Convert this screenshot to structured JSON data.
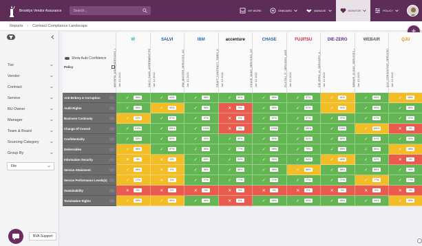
{
  "brand": {
    "name": "Brooklyn Vendor Assurance"
  },
  "search": {
    "placeholder": "Search..."
  },
  "nav": [
    {
      "label": "MY WORK",
      "icon": "inbox-icon",
      "active": false
    },
    {
      "label": "ONBOARD",
      "icon": "plus-circle-icon",
      "active": false
    },
    {
      "label": "MANAGE",
      "icon": "handshake-icon",
      "active": false
    },
    {
      "label": "MONITOR",
      "icon": "heart-pulse-icon",
      "active": true
    },
    {
      "label": "POLICY",
      "icon": "sliders-icon",
      "active": false
    }
  ],
  "breadcrumb": {
    "root": "Reports",
    "current": "Contract Compliance Landscape"
  },
  "sidebar": {
    "filters": [
      "Tier",
      "Vendor",
      "Contract",
      "Service",
      "BU Owner",
      "Manager",
      "Team & Board",
      "Sourcing Category",
      "Group By"
    ],
    "group_by_value": "File"
  },
  "support": {
    "label": "BVA Support"
  },
  "grid": {
    "toggle_label": "Show Auto Confidence",
    "policy_header": "Policy",
    "vendors": [
      {
        "logo": "W",
        "logo_color": "#1cb7b0",
        "name": "WEYSPIN_BSLM_SERVICES_AGRE...",
        "date": "Jan 12 2022"
      },
      {
        "logo": "SALVI",
        "logo_color": "#1d4f91",
        "name": "SALVI_SAAS_AGREEMENT.PDF",
        "date": "Jan 12 2022"
      },
      {
        "logo": "IBM",
        "logo_color": "#1f70c1",
        "name": "IBM_MASTER_SERVICES_AG...",
        "date": "Jan 12 2022"
      },
      {
        "logo": "accenture",
        "logo_color": "#111111",
        "name": "CRAFT_CONTRACT_TIMES_A...",
        "date": "Jan 12 2022"
      },
      {
        "logo": "CHASE",
        "logo_color": "#1a5fa8",
        "name": "CHASE_BANK_SERVICES_AG...",
        "date": "Jan 12 2022"
      },
      {
        "logo": "FUJITSU",
        "logo_color": "#d3172e",
        "name": "FUJITSU_IT_SERVICES_AGR...",
        "date": "Jan 12 2022"
      },
      {
        "logo": "DIE-ZERO",
        "logo_color": "#5b2c83",
        "name": "DIE-ZERO_AI_SERVICES_A...",
        "date": "Jan 12 2022"
      },
      {
        "logo": "WEBAIR",
        "logo_color": "#555555",
        "name": "WEBAIR_CLOUD_SERVICES_A...",
        "date": "Jan 12 2022"
      },
      {
        "logo": "QJU",
        "logo_color": "#e48b10",
        "name": "QJU_CONSULTING_SERVICES...",
        "date": "Jan 12 2022"
      }
    ],
    "rows": [
      {
        "policy": "Anti-Bribery & Corruption",
        "cells": [
          [
            "g",
            "96%"
          ],
          [
            "g",
            "94%"
          ],
          [
            "g",
            "98%"
          ],
          [
            "g",
            "92%"
          ],
          [
            "g",
            "95%"
          ],
          [
            "g",
            "97%"
          ],
          [
            "y",
            "91%"
          ],
          [
            "g",
            "99%"
          ],
          [
            "y",
            "89%"
          ]
        ]
      },
      {
        "policy": "Audit Rights",
        "cells": [
          [
            "g",
            "96%"
          ],
          [
            "y",
            "94%"
          ],
          [
            "g",
            "98%"
          ],
          [
            "r",
            "0%"
          ],
          [
            "g",
            "95%"
          ],
          [
            "g",
            "97%"
          ],
          [
            "y",
            "91%"
          ],
          [
            "g",
            "99%"
          ],
          [
            "g",
            "89%"
          ]
        ]
      },
      {
        "policy": "Business Continuity",
        "cells": [
          [
            "y",
            "97%"
          ],
          [
            "g",
            "97%"
          ],
          [
            "g",
            "97%"
          ],
          [
            "r",
            "0%"
          ],
          [
            "g",
            "97%"
          ],
          [
            "g",
            "97%"
          ],
          [
            "g",
            "97%"
          ],
          [
            "g",
            "97%"
          ],
          [
            "g",
            "97%"
          ]
        ]
      },
      {
        "policy": "Change Of Control",
        "cells": [
          [
            "g",
            "100%"
          ],
          [
            "g",
            "100%"
          ],
          [
            "g",
            "100%"
          ],
          [
            "r",
            "0%"
          ],
          [
            "g",
            "100%"
          ],
          [
            "g",
            "100%"
          ],
          [
            "g",
            "100%"
          ],
          [
            "y",
            "100%"
          ],
          [
            "r",
            "0%"
          ]
        ]
      },
      {
        "policy": "Confidentiality",
        "cells": [
          [
            "g",
            "92%"
          ],
          [
            "g",
            "92%"
          ],
          [
            "g",
            "92%"
          ],
          [
            "g",
            "92%"
          ],
          [
            "g",
            "92%"
          ],
          [
            "g",
            "92%"
          ],
          [
            "g",
            "92%"
          ],
          [
            "g",
            "91%"
          ],
          [
            "g",
            "92%"
          ]
        ]
      },
      {
        "policy": "Deliverables",
        "cells": [
          [
            "y",
            "98%"
          ],
          [
            "g",
            "97%"
          ],
          [
            "g",
            "96%"
          ],
          [
            "g",
            "77%"
          ],
          [
            "g",
            "98%"
          ],
          [
            "g",
            "79%"
          ],
          [
            "g",
            "99%"
          ],
          [
            "g",
            "98%"
          ],
          [
            "y",
            "98%"
          ]
        ]
      },
      {
        "policy": "Information Security",
        "cells": [
          [
            "y",
            "0%"
          ],
          [
            "y",
            "0%"
          ],
          [
            "g",
            "94%"
          ],
          [
            "g",
            "94%"
          ],
          [
            "g",
            "94%"
          ],
          [
            "g",
            "94%"
          ],
          [
            "y",
            "94%"
          ],
          [
            "g",
            "92%"
          ],
          [
            "r",
            "0%"
          ]
        ]
      },
      {
        "policy": "Service Attainment",
        "cells": [
          [
            "y",
            "98%"
          ],
          [
            "y",
            "0%"
          ],
          [
            "g",
            "98%"
          ],
          [
            "g",
            "98%"
          ],
          [
            "g",
            "98%"
          ],
          [
            "y",
            "98%"
          ],
          [
            "g",
            "98%"
          ],
          [
            "g",
            "98%"
          ],
          [
            "g",
            "98%"
          ]
        ]
      },
      {
        "policy": "Service Performance Levels(s)",
        "cells": [
          [
            "y",
            "77%"
          ],
          [
            "y",
            "0%"
          ],
          [
            "g",
            "77%"
          ],
          [
            "g",
            "77%"
          ],
          [
            "g",
            "77%"
          ],
          [
            "g",
            "77%"
          ],
          [
            "g",
            "77%"
          ],
          [
            "y",
            "77%"
          ],
          [
            "g",
            "77%"
          ]
        ]
      },
      {
        "policy": "Sustainability",
        "cells": [
          [
            "r",
            "0%"
          ],
          [
            "r",
            "0%"
          ],
          [
            "r",
            "0%"
          ],
          [
            "r",
            "0%"
          ],
          [
            "r",
            "0%"
          ],
          [
            "r",
            "0%"
          ],
          [
            "r",
            "0%"
          ],
          [
            "r",
            "0%"
          ],
          [
            "r",
            "0%"
          ]
        ]
      },
      {
        "policy": "Termination Rights",
        "cells": [
          [
            "y",
            "99%"
          ],
          [
            "y",
            "99%"
          ],
          [
            "g",
            "99%"
          ],
          [
            "r",
            "0%"
          ],
          [
            "g",
            "99%"
          ],
          [
            "g",
            "99%"
          ],
          [
            "g",
            "99%"
          ],
          [
            "g",
            "99%"
          ],
          [
            "y",
            "99%"
          ]
        ]
      }
    ]
  },
  "colors": {
    "g": "#64b553",
    "y": "#f2bd27",
    "r": "#ea5b4f",
    "brand": "#5d2d58"
  }
}
